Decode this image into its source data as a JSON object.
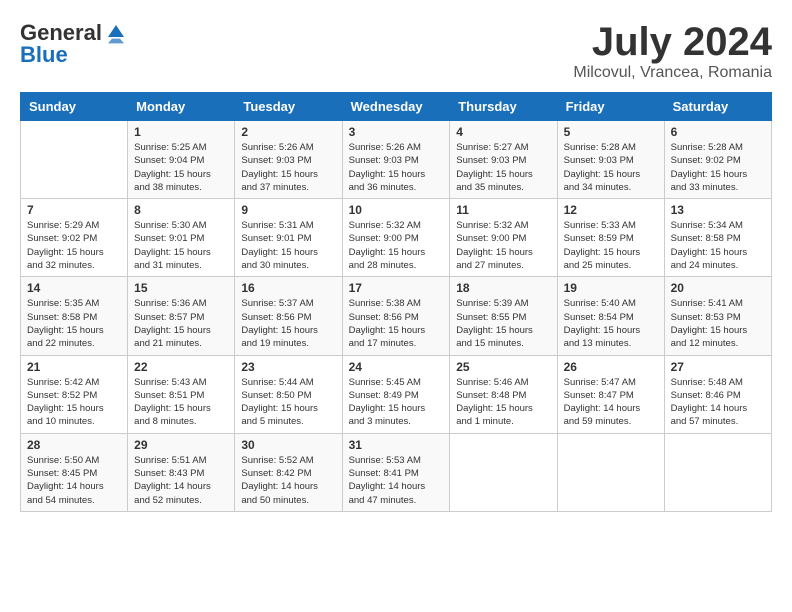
{
  "logo": {
    "general": "General",
    "blue": "Blue"
  },
  "title": "July 2024",
  "location": "Milcovul, Vrancea, Romania",
  "weekdays": [
    "Sunday",
    "Monday",
    "Tuesday",
    "Wednesday",
    "Thursday",
    "Friday",
    "Saturday"
  ],
  "weeks": [
    [
      {
        "day": "",
        "sunrise": "",
        "sunset": "",
        "daylight": ""
      },
      {
        "day": "1",
        "sunrise": "Sunrise: 5:25 AM",
        "sunset": "Sunset: 9:04 PM",
        "daylight": "Daylight: 15 hours and 38 minutes."
      },
      {
        "day": "2",
        "sunrise": "Sunrise: 5:26 AM",
        "sunset": "Sunset: 9:03 PM",
        "daylight": "Daylight: 15 hours and 37 minutes."
      },
      {
        "day": "3",
        "sunrise": "Sunrise: 5:26 AM",
        "sunset": "Sunset: 9:03 PM",
        "daylight": "Daylight: 15 hours and 36 minutes."
      },
      {
        "day": "4",
        "sunrise": "Sunrise: 5:27 AM",
        "sunset": "Sunset: 9:03 PM",
        "daylight": "Daylight: 15 hours and 35 minutes."
      },
      {
        "day": "5",
        "sunrise": "Sunrise: 5:28 AM",
        "sunset": "Sunset: 9:03 PM",
        "daylight": "Daylight: 15 hours and 34 minutes."
      },
      {
        "day": "6",
        "sunrise": "Sunrise: 5:28 AM",
        "sunset": "Sunset: 9:02 PM",
        "daylight": "Daylight: 15 hours and 33 minutes."
      }
    ],
    [
      {
        "day": "7",
        "sunrise": "Sunrise: 5:29 AM",
        "sunset": "Sunset: 9:02 PM",
        "daylight": "Daylight: 15 hours and 32 minutes."
      },
      {
        "day": "8",
        "sunrise": "Sunrise: 5:30 AM",
        "sunset": "Sunset: 9:01 PM",
        "daylight": "Daylight: 15 hours and 31 minutes."
      },
      {
        "day": "9",
        "sunrise": "Sunrise: 5:31 AM",
        "sunset": "Sunset: 9:01 PM",
        "daylight": "Daylight: 15 hours and 30 minutes."
      },
      {
        "day": "10",
        "sunrise": "Sunrise: 5:32 AM",
        "sunset": "Sunset: 9:00 PM",
        "daylight": "Daylight: 15 hours and 28 minutes."
      },
      {
        "day": "11",
        "sunrise": "Sunrise: 5:32 AM",
        "sunset": "Sunset: 9:00 PM",
        "daylight": "Daylight: 15 hours and 27 minutes."
      },
      {
        "day": "12",
        "sunrise": "Sunrise: 5:33 AM",
        "sunset": "Sunset: 8:59 PM",
        "daylight": "Daylight: 15 hours and 25 minutes."
      },
      {
        "day": "13",
        "sunrise": "Sunrise: 5:34 AM",
        "sunset": "Sunset: 8:58 PM",
        "daylight": "Daylight: 15 hours and 24 minutes."
      }
    ],
    [
      {
        "day": "14",
        "sunrise": "Sunrise: 5:35 AM",
        "sunset": "Sunset: 8:58 PM",
        "daylight": "Daylight: 15 hours and 22 minutes."
      },
      {
        "day": "15",
        "sunrise": "Sunrise: 5:36 AM",
        "sunset": "Sunset: 8:57 PM",
        "daylight": "Daylight: 15 hours and 21 minutes."
      },
      {
        "day": "16",
        "sunrise": "Sunrise: 5:37 AM",
        "sunset": "Sunset: 8:56 PM",
        "daylight": "Daylight: 15 hours and 19 minutes."
      },
      {
        "day": "17",
        "sunrise": "Sunrise: 5:38 AM",
        "sunset": "Sunset: 8:56 PM",
        "daylight": "Daylight: 15 hours and 17 minutes."
      },
      {
        "day": "18",
        "sunrise": "Sunrise: 5:39 AM",
        "sunset": "Sunset: 8:55 PM",
        "daylight": "Daylight: 15 hours and 15 minutes."
      },
      {
        "day": "19",
        "sunrise": "Sunrise: 5:40 AM",
        "sunset": "Sunset: 8:54 PM",
        "daylight": "Daylight: 15 hours and 13 minutes."
      },
      {
        "day": "20",
        "sunrise": "Sunrise: 5:41 AM",
        "sunset": "Sunset: 8:53 PM",
        "daylight": "Daylight: 15 hours and 12 minutes."
      }
    ],
    [
      {
        "day": "21",
        "sunrise": "Sunrise: 5:42 AM",
        "sunset": "Sunset: 8:52 PM",
        "daylight": "Daylight: 15 hours and 10 minutes."
      },
      {
        "day": "22",
        "sunrise": "Sunrise: 5:43 AM",
        "sunset": "Sunset: 8:51 PM",
        "daylight": "Daylight: 15 hours and 8 minutes."
      },
      {
        "day": "23",
        "sunrise": "Sunrise: 5:44 AM",
        "sunset": "Sunset: 8:50 PM",
        "daylight": "Daylight: 15 hours and 5 minutes."
      },
      {
        "day": "24",
        "sunrise": "Sunrise: 5:45 AM",
        "sunset": "Sunset: 8:49 PM",
        "daylight": "Daylight: 15 hours and 3 minutes."
      },
      {
        "day": "25",
        "sunrise": "Sunrise: 5:46 AM",
        "sunset": "Sunset: 8:48 PM",
        "daylight": "Daylight: 15 hours and 1 minute."
      },
      {
        "day": "26",
        "sunrise": "Sunrise: 5:47 AM",
        "sunset": "Sunset: 8:47 PM",
        "daylight": "Daylight: 14 hours and 59 minutes."
      },
      {
        "day": "27",
        "sunrise": "Sunrise: 5:48 AM",
        "sunset": "Sunset: 8:46 PM",
        "daylight": "Daylight: 14 hours and 57 minutes."
      }
    ],
    [
      {
        "day": "28",
        "sunrise": "Sunrise: 5:50 AM",
        "sunset": "Sunset: 8:45 PM",
        "daylight": "Daylight: 14 hours and 54 minutes."
      },
      {
        "day": "29",
        "sunrise": "Sunrise: 5:51 AM",
        "sunset": "Sunset: 8:43 PM",
        "daylight": "Daylight: 14 hours and 52 minutes."
      },
      {
        "day": "30",
        "sunrise": "Sunrise: 5:52 AM",
        "sunset": "Sunset: 8:42 PM",
        "daylight": "Daylight: 14 hours and 50 minutes."
      },
      {
        "day": "31",
        "sunrise": "Sunrise: 5:53 AM",
        "sunset": "Sunset: 8:41 PM",
        "daylight": "Daylight: 14 hours and 47 minutes."
      },
      {
        "day": "",
        "sunrise": "",
        "sunset": "",
        "daylight": ""
      },
      {
        "day": "",
        "sunrise": "",
        "sunset": "",
        "daylight": ""
      },
      {
        "day": "",
        "sunrise": "",
        "sunset": "",
        "daylight": ""
      }
    ]
  ]
}
